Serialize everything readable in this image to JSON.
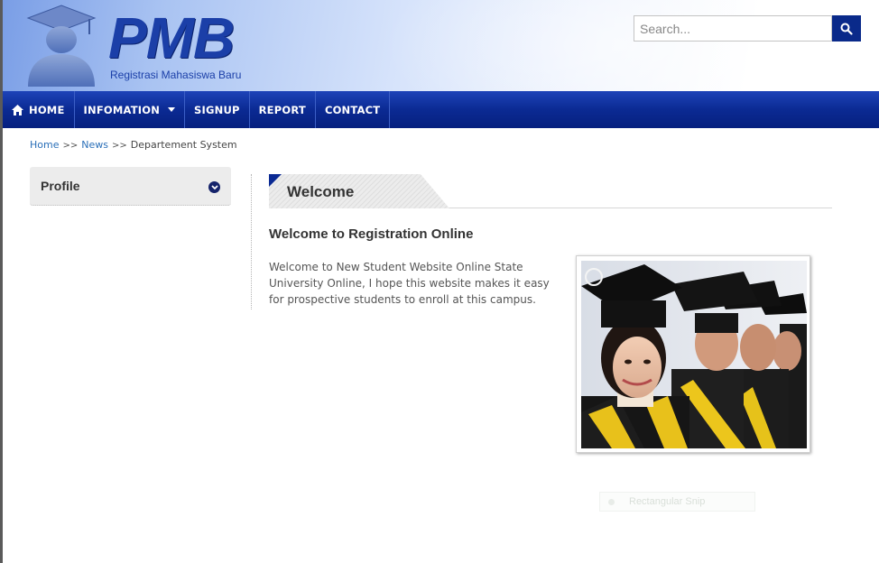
{
  "logo": {
    "title": "PMB",
    "subtitle": "Registrasi Mahasiswa Baru"
  },
  "search": {
    "placeholder": "Search...",
    "icon": "search-icon"
  },
  "nav": {
    "items": [
      {
        "label": "HOME",
        "icon": "home-icon"
      },
      {
        "label": "INFOMATION",
        "has_dropdown": true
      },
      {
        "label": "SIGNUP"
      },
      {
        "label": "REPORT"
      },
      {
        "label": "CONTACT"
      }
    ]
  },
  "breadcrumb": {
    "items": [
      "Home",
      "News",
      "Departement System"
    ],
    "separator": ">>"
  },
  "sidebar": {
    "profile_label": "Profile",
    "icon": "chevron-down-circle-icon"
  },
  "main": {
    "tab_title": "Welcome",
    "heading": "Welcome to Registration Online",
    "body": "Welcome to New Student Website Online State University Online, I hope this website makes it easy for prospective students to enroll at this campus.",
    "image": "graduates-photo"
  },
  "overlay": {
    "ghost_label": "Rectangular Snip"
  },
  "colors": {
    "nav_blue": "#0b2a93",
    "brand_blue": "#1b3fa8",
    "link_blue": "#2a6fb8",
    "search_button": "#0a2a8a"
  }
}
